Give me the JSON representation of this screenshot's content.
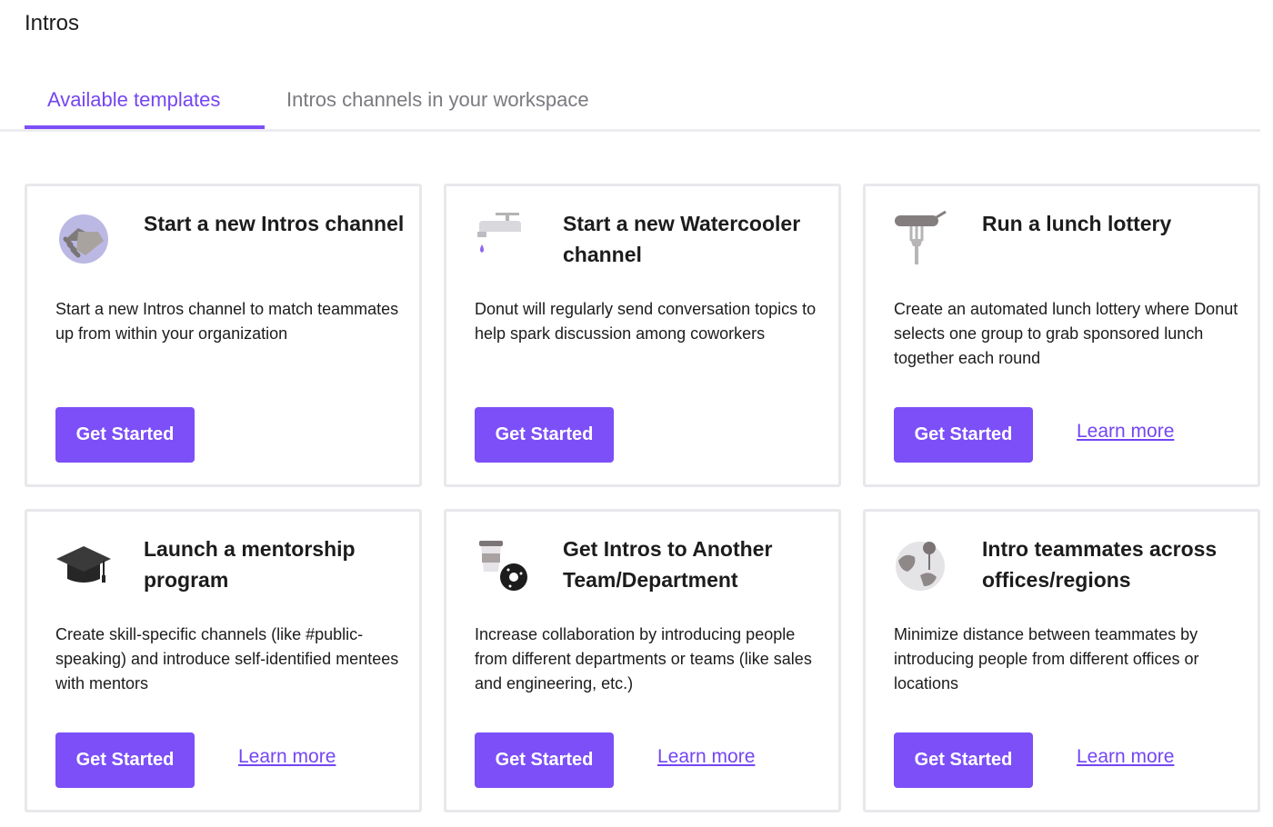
{
  "page": {
    "title": "Intros"
  },
  "tabs": [
    {
      "label": "Available templates",
      "active": true
    },
    {
      "label": "Intros channels in your workspace",
      "active": false
    }
  ],
  "colors": {
    "accent": "#7c4ff8",
    "tab_active": "#7446f2",
    "border": "#e8e8ec"
  },
  "cards": [
    {
      "icon": "handshake-icon",
      "title": "Start a new Intros channel",
      "description": "Start a new Intros channel to match teammates up from within your organization",
      "button_label": "Get Started",
      "learn_more": ""
    },
    {
      "icon": "faucet-icon",
      "title": "Start a new Watercooler channel",
      "description": "Donut will regularly send conversation topics to help spark discussion among coworkers",
      "button_label": "Get Started",
      "learn_more": ""
    },
    {
      "icon": "fork-icon",
      "title": "Run a lunch lottery",
      "description": "Create an automated lunch lottery where Donut selects one group to grab sponsored lunch together each round",
      "button_label": "Get Started",
      "learn_more": "Learn more"
    },
    {
      "icon": "graduation-cap-icon",
      "title": "Launch a mentorship program",
      "description": "Create skill-specific channels (like #public-speaking) and introduce self-identified mentees with mentors",
      "button_label": "Get Started",
      "learn_more": "Learn more"
    },
    {
      "icon": "coffee-donut-icon",
      "title": "Get Intros to Another Team/Department",
      "description": "Increase collaboration by introducing people from different departments or teams (like sales and engineering, etc.)",
      "button_label": "Get Started",
      "learn_more": "Learn more"
    },
    {
      "icon": "globe-pin-icon",
      "title": "Intro teammates across offices/regions",
      "description": "Minimize distance between teammates by introducing people from different offices or locations",
      "button_label": "Get Started",
      "learn_more": "Learn more"
    }
  ]
}
